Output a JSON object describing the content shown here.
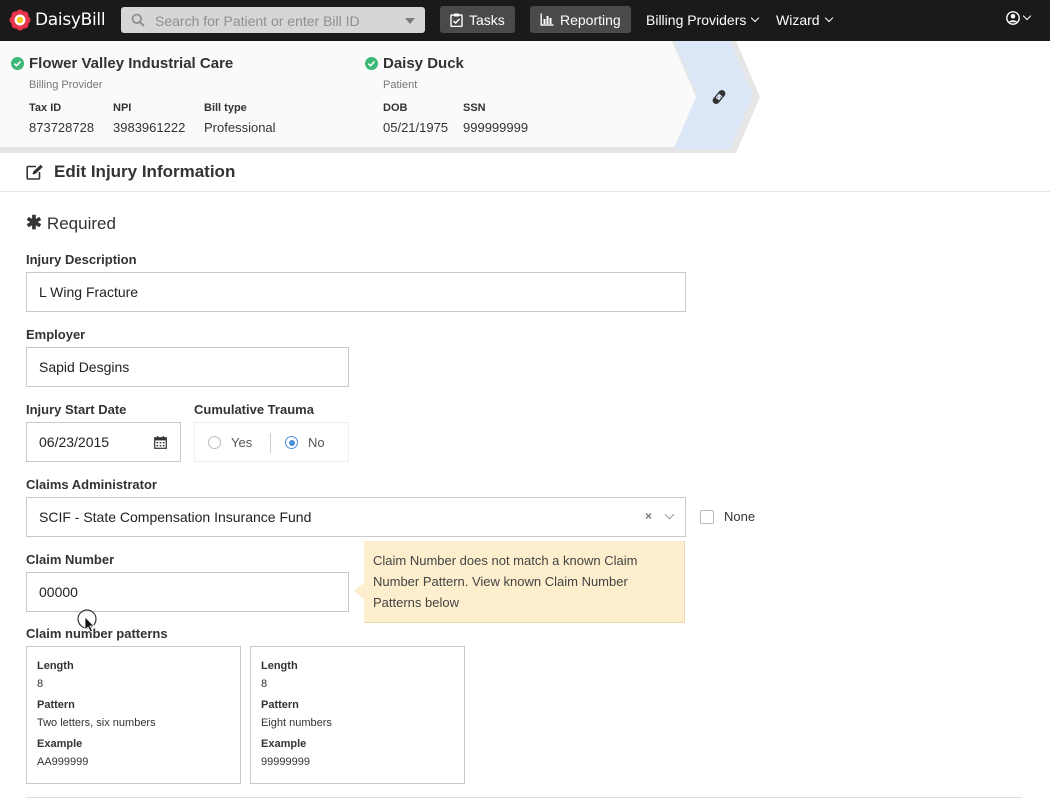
{
  "nav": {
    "logo_text": "DaisyBill",
    "search_placeholder": "Search for Patient or enter Bill ID",
    "tasks_label": "Tasks",
    "reporting_label": "Reporting",
    "billing_providers_label": "Billing Providers",
    "wizard_label": "Wizard",
    "user_icon": "user-circle-icon"
  },
  "provider": {
    "name": "Flower Valley Industrial Care",
    "role": "Billing Provider",
    "fields": [
      {
        "label": "Tax ID",
        "value": "873728728"
      },
      {
        "label": "NPI",
        "value": "3983961222"
      },
      {
        "label": "Bill type",
        "value": "Professional"
      }
    ]
  },
  "patient": {
    "name": "Daisy Duck",
    "role": "Patient",
    "fields": [
      {
        "label": "DOB",
        "value": "05/21/1975"
      },
      {
        "label": "SSN",
        "value": "999999999"
      }
    ]
  },
  "form": {
    "section_title": "Edit Injury Information",
    "required_label": "Required",
    "injury_description": {
      "label": "Injury Description",
      "value": "L Wing Fracture"
    },
    "employer": {
      "label": "Employer",
      "value": "Sapid Desgins"
    },
    "injury_start_date": {
      "label": "Injury Start Date",
      "value": "06/23/2015"
    },
    "cumulative_trauma": {
      "label": "Cumulative Trauma",
      "options": [
        "Yes",
        "No"
      ],
      "selected": "No"
    },
    "claims_administrator": {
      "label": "Claims Administrator",
      "value": "SCIF - State Compensation Insurance Fund",
      "clear": "×",
      "none_label": "None"
    },
    "claim_number": {
      "label": "Claim Number",
      "value": "00000"
    },
    "claim_tooltip": "Claim Number does not match a known Claim Number Pattern. View known Claim Number Patterns below",
    "patterns_label": "Claim number patterns",
    "patterns": [
      {
        "length_label": "Length",
        "length": "8",
        "pattern_label": "Pattern",
        "pattern": "Two letters, six numbers",
        "example_label": "Example",
        "example": "AA999999"
      },
      {
        "length_label": "Length",
        "length": "8",
        "pattern_label": "Pattern",
        "pattern": "Eight numbers",
        "example_label": "Example",
        "example": "99999999"
      }
    ]
  },
  "colors": {
    "nav_bg": "#1a1a1a",
    "check_green": "#3cb878",
    "radio_blue": "#4a90d9",
    "tooltip_bg": "#fdeecd",
    "chevron_blue": "#dbe6f6"
  }
}
